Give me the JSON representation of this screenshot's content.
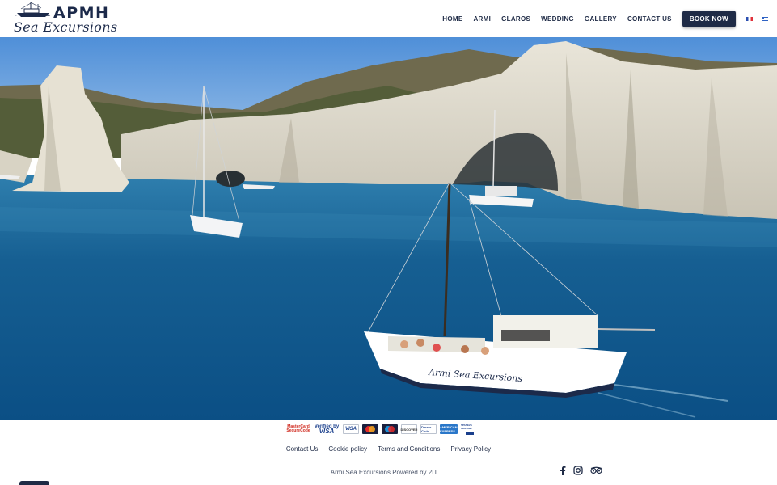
{
  "brand": {
    "title": "APMH",
    "subtitle": "Sea Excursions"
  },
  "nav": {
    "items": [
      {
        "label": "HOME"
      },
      {
        "label": "ARMI"
      },
      {
        "label": "GLAROS"
      },
      {
        "label": "WEDDING"
      },
      {
        "label": "GALLERY"
      },
      {
        "label": "CONTACT US"
      }
    ],
    "book_label": "BOOK NOW",
    "languages": [
      "fr-flag-icon",
      "gr-flag-icon"
    ]
  },
  "hero": {
    "boat_hull_text": "Armi Sea Excursions"
  },
  "payments": {
    "mastercard_securecode": "MasterCard SecureCode",
    "verified_by": "Verified by",
    "verified_visa": "VISA",
    "visa": "VISA",
    "discover": "DISCOVER",
    "diners": "Diners Club",
    "amex": "AMERICAN EXPRESS",
    "bank": "ΤΡΑΠΕΖΑ ΠΕΙΡΑΙΩΣ"
  },
  "footer": {
    "links": [
      {
        "label": "Contact Us"
      },
      {
        "label": "Cookie policy"
      },
      {
        "label": "Terms and Conditions"
      },
      {
        "label": "Privacy Policy"
      }
    ],
    "powered": "Armi Sea Excursions Powered by 2IT",
    "social": [
      "facebook-icon",
      "instagram-icon",
      "tripadvisor-icon"
    ]
  },
  "colors": {
    "brand_navy": "#1f2b46",
    "sea": "#0f5c8c",
    "sky": "#5d95d8"
  }
}
